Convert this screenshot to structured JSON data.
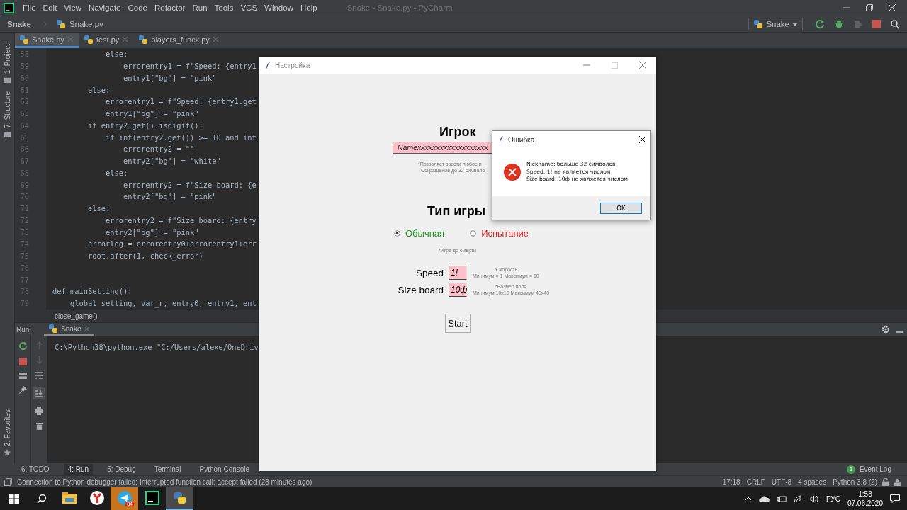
{
  "ide": {
    "menus": [
      "File",
      "Edit",
      "View",
      "Navigate",
      "Code",
      "Refactor",
      "Run",
      "Tools",
      "VCS",
      "Window",
      "Help"
    ],
    "title": "Snake - Snake.py - PyCharm",
    "breadcrumb": [
      "Snake",
      "Snake.py"
    ],
    "run_config": "Snake",
    "left_strip": {
      "top": [
        "1: Project",
        "7: Structure"
      ],
      "bottom": [
        "2: Favorites"
      ]
    },
    "editor_tabs": [
      {
        "label": "Snake.py",
        "selected": true
      },
      {
        "label": "test.py",
        "selected": false
      },
      {
        "label": "players_funck.py",
        "selected": false
      }
    ],
    "code_lines": [
      {
        "number": "58",
        "text": "            else:"
      },
      {
        "number": "59",
        "text": "                errorentry1 = f\"Speed: {entry1"
      },
      {
        "number": "60",
        "text": "                entry1[\"bg\"] = \"pink\""
      },
      {
        "number": "61",
        "text": "        else:"
      },
      {
        "number": "62",
        "text": "            errorentry1 = f\"Speed: {entry1.get"
      },
      {
        "number": "63",
        "text": "            entry1[\"bg\"] = \"pink\""
      },
      {
        "number": "64",
        "text": "        if entry2.get().isdigit():"
      },
      {
        "number": "65",
        "text": "            if int(entry2.get()) >= 10 and int"
      },
      {
        "number": "66",
        "text": "                errorentry2 = \"\""
      },
      {
        "number": "67",
        "text": "                entry2[\"bg\"] = \"white\""
      },
      {
        "number": "68",
        "text": "            else:"
      },
      {
        "number": "69",
        "text": "                errorentry2 = f\"Size board: {e"
      },
      {
        "number": "70",
        "text": "                entry2[\"bg\"] = \"pink\""
      },
      {
        "number": "71",
        "text": "        else:"
      },
      {
        "number": "72",
        "text": "            errorentry2 = f\"Size board: {entry"
      },
      {
        "number": "73",
        "text": "            entry2[\"bg\"] = \"pink\""
      },
      {
        "number": "74",
        "text": "        errorlog = errorentry0+errorentry1+err"
      },
      {
        "number": "75",
        "text": "        root.after(1, check_error)"
      },
      {
        "number": "76"
      },
      {
        "number": "77"
      },
      {
        "number": "78",
        "text": "def mainSetting():"
      },
      {
        "number": "79",
        "text": "    global setting, var_r, entry0, entry1, ent"
      }
    ],
    "scope": "close_game()",
    "run_panel": {
      "label": "Run:",
      "tab": "Snake",
      "output": "C:\\Python38\\python.exe \"C:/Users/alexe/OneDriv"
    },
    "tool_tabs": [
      {
        "label": "6: TODO",
        "selected": false
      },
      {
        "label": "4: Run",
        "selected": true
      },
      {
        "label": "5: Debug",
        "selected": false
      },
      {
        "label": "Terminal",
        "selected": false
      },
      {
        "label": "Python Console",
        "selected": false
      }
    ],
    "event_log": {
      "count": "1",
      "label": "Event Log"
    },
    "status_message": "Connection to Python debugger failed: Interrupted function call: accept failed (28 minutes ago)",
    "status_items": [
      "17:18",
      "CRLF",
      "UTF-8",
      "4 spaces",
      "Python 3.8 (2)"
    ]
  },
  "settings_window": {
    "title": "Настройка",
    "player_heading": "Игрок",
    "name_entry": "Namexxxxxxxxxxxxxxxxxxx",
    "name_hints": [
      "*Позволяет ввести любое и",
      "Сокращение до 32 символо"
    ],
    "mode_heading": "Тип игры",
    "modes": [
      {
        "label": "Обычная",
        "selected": true,
        "color": "#1e9a1e"
      },
      {
        "label": "Испытание",
        "selected": false,
        "color": "#e8201e"
      }
    ],
    "mode_hint": "*Игра до смерти",
    "fields": [
      {
        "label": "Speed",
        "value": "1!",
        "hints": [
          "*Скорость",
          "Минимум = 1  Максимум = 10"
        ]
      },
      {
        "label": "Size board",
        "value": "10ф",
        "hints": [
          "*Размер поля",
          "Минимум 10x10  Максимум 40x40"
        ]
      }
    ],
    "start_button": "Start"
  },
  "error_dialog": {
    "title": "Ошибка",
    "messages": [
      "Nickname: больше 32 символов",
      "Speed: 1! не является числом",
      "Size board: 10ф не является числом"
    ],
    "ok_button": "OK"
  },
  "taskbar": {
    "apps": [
      {
        "kind": "files",
        "selected": false,
        "attention": false
      },
      {
        "kind": "browser",
        "selected": false,
        "attention": false
      },
      {
        "kind": "messenger",
        "selected": false,
        "attention": true,
        "badge": "84"
      },
      {
        "kind": "ide",
        "selected": false,
        "attention": false
      },
      {
        "kind": "python",
        "selected": true,
        "attention": false
      }
    ],
    "language": "РУС",
    "time": "1:58",
    "date": "07.06.2020"
  }
}
